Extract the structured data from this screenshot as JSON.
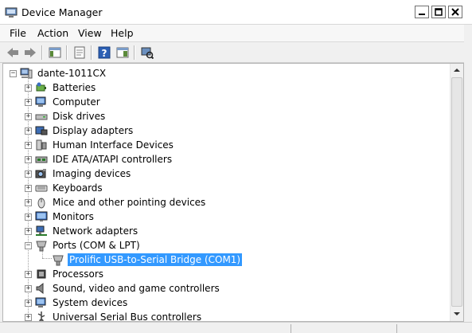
{
  "window": {
    "title": "Device Manager"
  },
  "menu": [
    "File",
    "Action",
    "View",
    "Help"
  ],
  "tree": {
    "root": "dante-1011CX",
    "items": [
      {
        "label": "Batteries",
        "icon": "battery-icon",
        "expander": "+"
      },
      {
        "label": "Computer",
        "icon": "computer-icon",
        "expander": "+"
      },
      {
        "label": "Disk drives",
        "icon": "disk-drive-icon",
        "expander": "+"
      },
      {
        "label": "Display adapters",
        "icon": "display-adapter-icon",
        "expander": "+"
      },
      {
        "label": "Human Interface Devices",
        "icon": "hid-icon",
        "expander": "+"
      },
      {
        "label": "IDE ATA/ATAPI controllers",
        "icon": "ide-controller-icon",
        "expander": "+"
      },
      {
        "label": "Imaging devices",
        "icon": "camera-icon",
        "expander": "+"
      },
      {
        "label": "Keyboards",
        "icon": "keyboard-icon",
        "expander": "+"
      },
      {
        "label": "Mice and other pointing devices",
        "icon": "mouse-icon",
        "expander": "+"
      },
      {
        "label": "Monitors",
        "icon": "monitor-icon",
        "expander": "+"
      },
      {
        "label": "Network adapters",
        "icon": "network-adapter-icon",
        "expander": "+"
      },
      {
        "label": "Ports (COM & LPT)",
        "icon": "port-icon",
        "expander": "-"
      },
      {
        "label": "Prolific USB-to-Serial Bridge (COM1)",
        "icon": "port-icon",
        "child": true,
        "selected": true
      },
      {
        "label": "Processors",
        "icon": "processor-icon",
        "expander": "+"
      },
      {
        "label": "Sound, video and game controllers",
        "icon": "speaker-icon",
        "expander": "+"
      },
      {
        "label": "System devices",
        "icon": "system-device-icon",
        "expander": "+"
      },
      {
        "label": "Universal Serial Bus controllers",
        "icon": "usb-icon",
        "expander": "+"
      }
    ]
  },
  "colors": {
    "selection": "#3399ff",
    "background": "#ffffff",
    "chrome": "#f0f0f0"
  }
}
